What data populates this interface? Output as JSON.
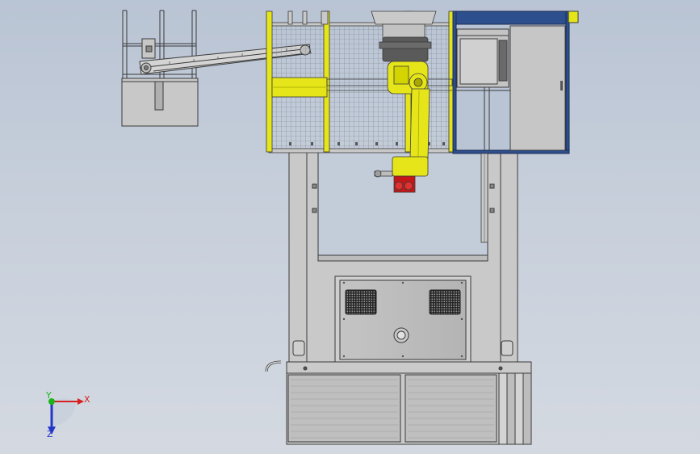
{
  "triad": {
    "x_label": "X",
    "y_label": "Y",
    "z_label": "Z",
    "x_color": "#d62020",
    "y_color": "#1bb51b",
    "z_color": "#2436c8"
  },
  "colors": {
    "background_top": "#b9c4d4",
    "background_bottom": "#d4d9e1",
    "frame_fill": "#c9c9c9",
    "frame_line": "#3a3a3a",
    "robot_yellow": "#e5e51a",
    "robot_yellow_dark": "#a8a800",
    "cabinet_blue": "#2d4f8e",
    "gripper_red": "#c41818",
    "mesh_line": "#7b8089"
  },
  "components": {
    "fence": "safety-fence-mesh",
    "robot": "yellow-robot-arm",
    "cabinet": "blue-control-cabinet",
    "conveyor": "inclined-conveyor",
    "base": "machine-base-frame",
    "gripper": "red-gripper-tool",
    "vents": "ventilation-grilles"
  }
}
